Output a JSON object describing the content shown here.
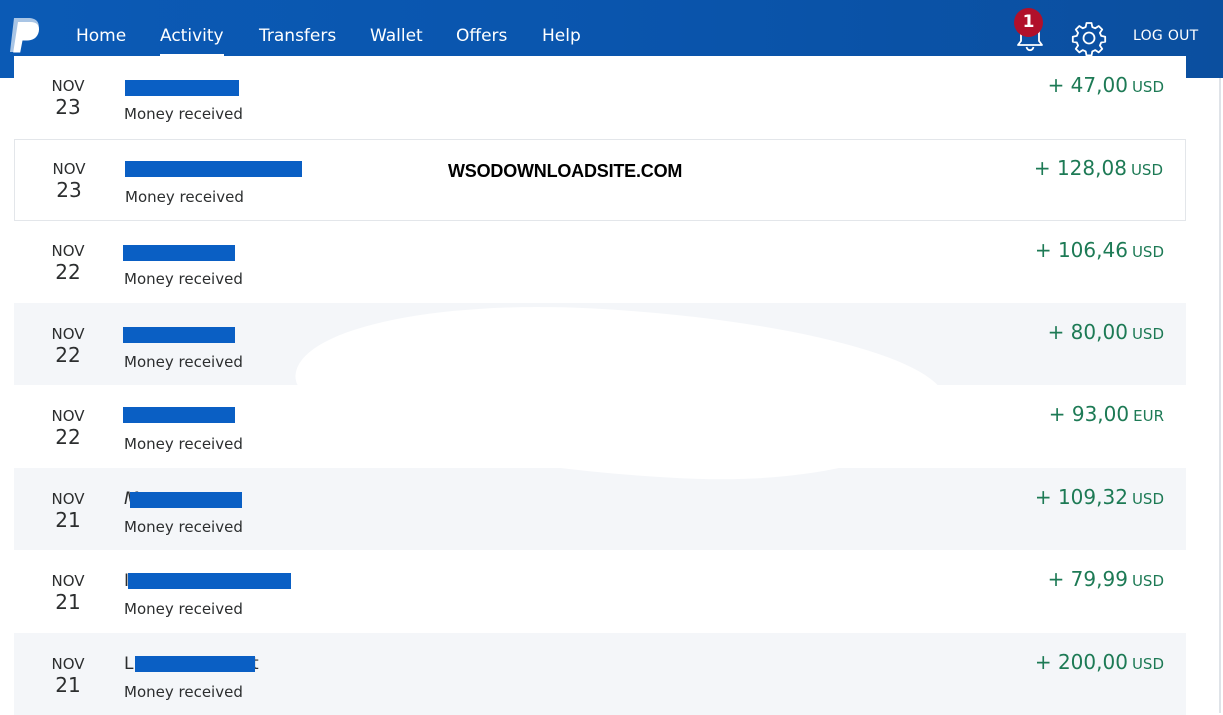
{
  "nav": {
    "items": [
      {
        "label": "Home",
        "active": false
      },
      {
        "label": "Activity",
        "active": true
      },
      {
        "label": "Transfers",
        "active": false
      },
      {
        "label": "Wallet",
        "active": false
      },
      {
        "label": "Offers",
        "active": false
      },
      {
        "label": "Help",
        "active": false
      }
    ],
    "notification_count": "1",
    "logout_label": "LOG OUT"
  },
  "watermark": "WSODOWNLOADSITE.COM",
  "colors": {
    "brand_blue": "#0a55ad",
    "amount_green": "#1d7a55",
    "badge_red": "#b1102a",
    "redaction": "#0a5fc4"
  },
  "transactions": [
    {
      "month": "NOV",
      "day": "23",
      "name_visible": "",
      "description": "Money received",
      "amount": "+ 47,00",
      "currency": "USD"
    },
    {
      "month": "NOV",
      "day": "23",
      "name_visible": "",
      "description": "Money received",
      "amount": "+ 128,08",
      "currency": "USD"
    },
    {
      "month": "NOV",
      "day": "22",
      "name_visible": "",
      "description": "Money received",
      "amount": "+ 106,46",
      "currency": "USD"
    },
    {
      "month": "NOV",
      "day": "22",
      "name_visible": "",
      "description": "Money received",
      "amount": "+ 80,00",
      "currency": "USD"
    },
    {
      "month": "NOV",
      "day": "22",
      "name_visible": "",
      "description": "Money received",
      "amount": "+ 93,00",
      "currency": "EUR"
    },
    {
      "month": "NOV",
      "day": "21",
      "name_visible": "M",
      "description": "Money received",
      "amount": "+ 109,32",
      "currency": "USD"
    },
    {
      "month": "NOV",
      "day": "21",
      "name_visible": "I                          a",
      "description": "Money received",
      "amount": "+ 79,99",
      "currency": "USD"
    },
    {
      "month": "NOV",
      "day": "21",
      "name_visible": "L                    et",
      "description": "Money received",
      "amount": "+ 200,00",
      "currency": "USD"
    }
  ]
}
